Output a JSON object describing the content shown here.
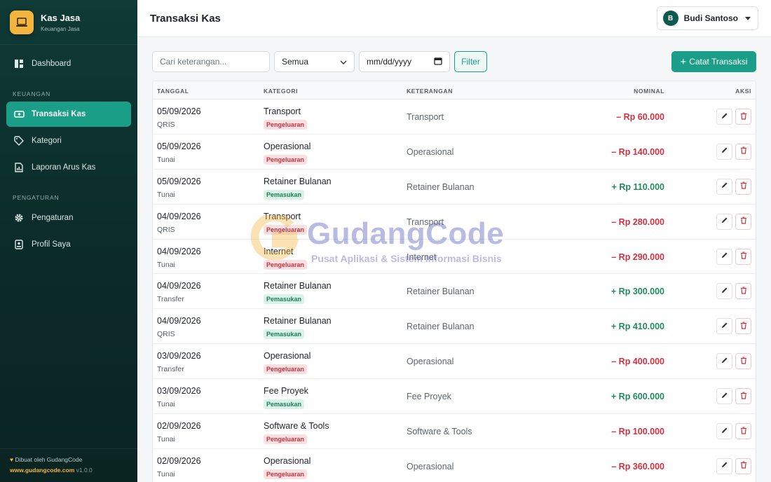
{
  "brand": {
    "title": "Kas Jasa",
    "subtitle": "Keuangan Jasa",
    "logo_icon": "laptop-icon",
    "accent": "#f3b53d"
  },
  "sidebar": {
    "items": [
      {
        "label": "Dashboard",
        "icon": "dashboard-icon",
        "active": false
      },
      {
        "label": "Transaksi Kas",
        "icon": "cash-icon",
        "active": true
      },
      {
        "label": "Kategori",
        "icon": "tag-icon",
        "active": false
      },
      {
        "label": "Laporan Arus Kas",
        "icon": "report-icon",
        "active": false
      },
      {
        "label": "Pengaturan",
        "icon": "gear-icon",
        "active": false
      },
      {
        "label": "Profil Saya",
        "icon": "profile-icon",
        "active": false
      }
    ],
    "sections": [
      "KEUANGAN",
      "PENGATURAN"
    ],
    "footer": {
      "credit": "Dibuat oleh GudangCode",
      "url": "www.gudangcode.com",
      "version": "v1.0.0"
    }
  },
  "header": {
    "title": "Transaksi Kas",
    "user": {
      "initial": "B",
      "name": "Budi Santoso"
    }
  },
  "toolbar": {
    "search_placeholder": "Cari keterangan...",
    "type_select": "Semua",
    "date_placeholder": "mm/dd/yyyy",
    "filter_label": "Filter",
    "add_label": "Catat Transaksi"
  },
  "table": {
    "headers": {
      "date": "TANGGAL",
      "category": "KATEGORI",
      "description": "KETERANGAN",
      "amount": "NOMINAL",
      "actions": "AKSI"
    },
    "rows": [
      {
        "date": "05/09/2026",
        "method": "QRIS",
        "category": "Transport",
        "type": "Pengeluaran",
        "description": "Transport",
        "amount": "– Rp 60.000"
      },
      {
        "date": "05/09/2026",
        "method": "Tunai",
        "category": "Operasional",
        "type": "Pengeluaran",
        "description": "Operasional",
        "amount": "– Rp 140.000"
      },
      {
        "date": "05/09/2026",
        "method": "Tunai",
        "category": "Retainer Bulanan",
        "type": "Pemasukan",
        "description": "Retainer Bulanan",
        "amount": "+ Rp 110.000"
      },
      {
        "date": "04/09/2026",
        "method": "QRIS",
        "category": "Transport",
        "type": "Pengeluaran",
        "description": "Transport",
        "amount": "– Rp 280.000"
      },
      {
        "date": "04/09/2026",
        "method": "Tunai",
        "category": "Internet",
        "type": "Pengeluaran",
        "description": "Internet",
        "amount": "– Rp 290.000"
      },
      {
        "date": "04/09/2026",
        "method": "Transfer",
        "category": "Retainer Bulanan",
        "type": "Pemasukan",
        "description": "Retainer Bulanan",
        "amount": "+ Rp 300.000"
      },
      {
        "date": "04/09/2026",
        "method": "QRIS",
        "category": "Retainer Bulanan",
        "type": "Pemasukan",
        "description": "Retainer Bulanan",
        "amount": "+ Rp 410.000"
      },
      {
        "date": "03/09/2026",
        "method": "Transfer",
        "category": "Operasional",
        "type": "Pengeluaran",
        "description": "Operasional",
        "amount": "– Rp 400.000"
      },
      {
        "date": "03/09/2026",
        "method": "Tunai",
        "category": "Fee Proyek",
        "type": "Pemasukan",
        "description": "Fee Proyek",
        "amount": "+ Rp 600.000"
      },
      {
        "date": "02/09/2026",
        "method": "Tunai",
        "category": "Software & Tools",
        "type": "Pengeluaran",
        "description": "Software & Tools",
        "amount": "– Rp 100.000"
      },
      {
        "date": "02/09/2026",
        "method": "Tunai",
        "category": "Operasional",
        "type": "Pengeluaran",
        "description": "Operasional",
        "amount": "– Rp 360.000"
      }
    ]
  },
  "watermark": {
    "title": "GudangCode",
    "subtitle": "Pusat Aplikasi & Sistem Informasi Bisnis"
  },
  "colors": {
    "primary": "#1a9e87",
    "expense": "#d3303f",
    "income": "#1f8a5b",
    "sidebar": "#0f3a36"
  }
}
